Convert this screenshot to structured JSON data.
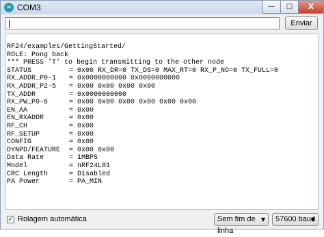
{
  "window": {
    "title": "COM3",
    "controls": {
      "minimize": "—",
      "maximize": "□",
      "close": "X"
    },
    "app_icon": "∞"
  },
  "input": {
    "value": "",
    "send_label": "Enviar"
  },
  "console": {
    "lines": [
      "RF24/examples/GettingStarted/",
      "ROLE: Pong back",
      "*** PRESS 'T' to begin transmitting to the other node",
      "STATUS",
      "RX_ADDR_P0-1",
      "RX_ADDR_P2-5",
      "TX_ADDR",
      "RX_PW_P0-6",
      "EN_AA",
      "EN_RXADDR",
      "RF_CH",
      "RF_SETUP",
      "CONFIG",
      "DYNPD/FEATURE",
      "Data Rate",
      "Model",
      "CRC Length",
      "PA Power"
    ],
    "values": [
      "",
      "",
      "",
      "= 0x00 RX_DR=0 TX_DS=0 MAX_RT=0 RX_P_NO=0 TX_FULL=0",
      "= 0x0000000000 0x0000000000",
      "= 0x00 0x00 0x00 0x00",
      "= 0x0000000000",
      "= 0x00 0x00 0x00 0x00 0x00 0x00",
      "= 0x00",
      "= 0x00",
      "= 0x00",
      "= 0x00",
      "= 0x00",
      "= 0x00 0x00",
      "= 1MBPS",
      "= nRF24L01",
      "= Disabled",
      "= PA_MIN"
    ]
  },
  "footer": {
    "autoscroll_label": "Rolagem automática",
    "autoscroll_checked": true,
    "line_ending": "Sem fim de linha",
    "baud": "57600 baud"
  }
}
